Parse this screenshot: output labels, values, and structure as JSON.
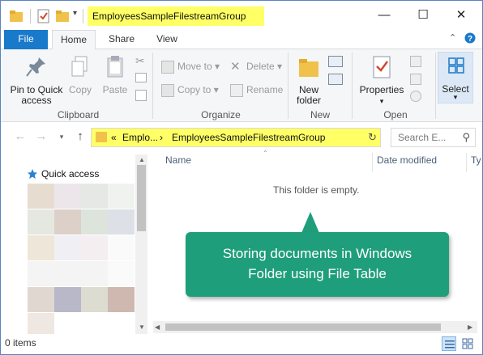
{
  "title": {
    "path_text": "EmployeesSampleFilestreamGroup",
    "highlight_color": "#ffff66"
  },
  "window_controls": {
    "minimize": "—",
    "maximize": "☐",
    "close": "✕"
  },
  "tabs": [
    {
      "label": "File"
    },
    {
      "label": "Home"
    },
    {
      "label": "Share"
    },
    {
      "label": "View"
    }
  ],
  "ribbon": {
    "clipboard": {
      "label": "Clipboard",
      "pin_label": "Pin to Quick access",
      "copy_label": "Copy",
      "paste_label": "Paste"
    },
    "organize": {
      "label": "Organize",
      "move_to": "Move to",
      "copy_to": "Copy to",
      "delete": "Delete",
      "rename": "Rename"
    },
    "new": {
      "label": "New",
      "new_folder": "New folder"
    },
    "open": {
      "label": "Open",
      "properties": "Properties"
    },
    "select": {
      "label": "Select"
    }
  },
  "address_bar": {
    "chevrons": "«",
    "crumb1": "Emplo...",
    "separator": "›",
    "crumb2": "EmployeesSampleFilestreamGroup",
    "search_placeholder": "Search E..."
  },
  "nav_pane": {
    "quick_access": "Quick access"
  },
  "columns": [
    {
      "label": "Name"
    },
    {
      "label": "Date modified"
    },
    {
      "label": "Ty"
    }
  ],
  "content": {
    "empty_message": "This folder is empty."
  },
  "callout": {
    "line1": "Storing documents in Windows",
    "line2": "Folder using File Table",
    "color": "#1f9e7b"
  },
  "status": {
    "items": "0 items"
  }
}
